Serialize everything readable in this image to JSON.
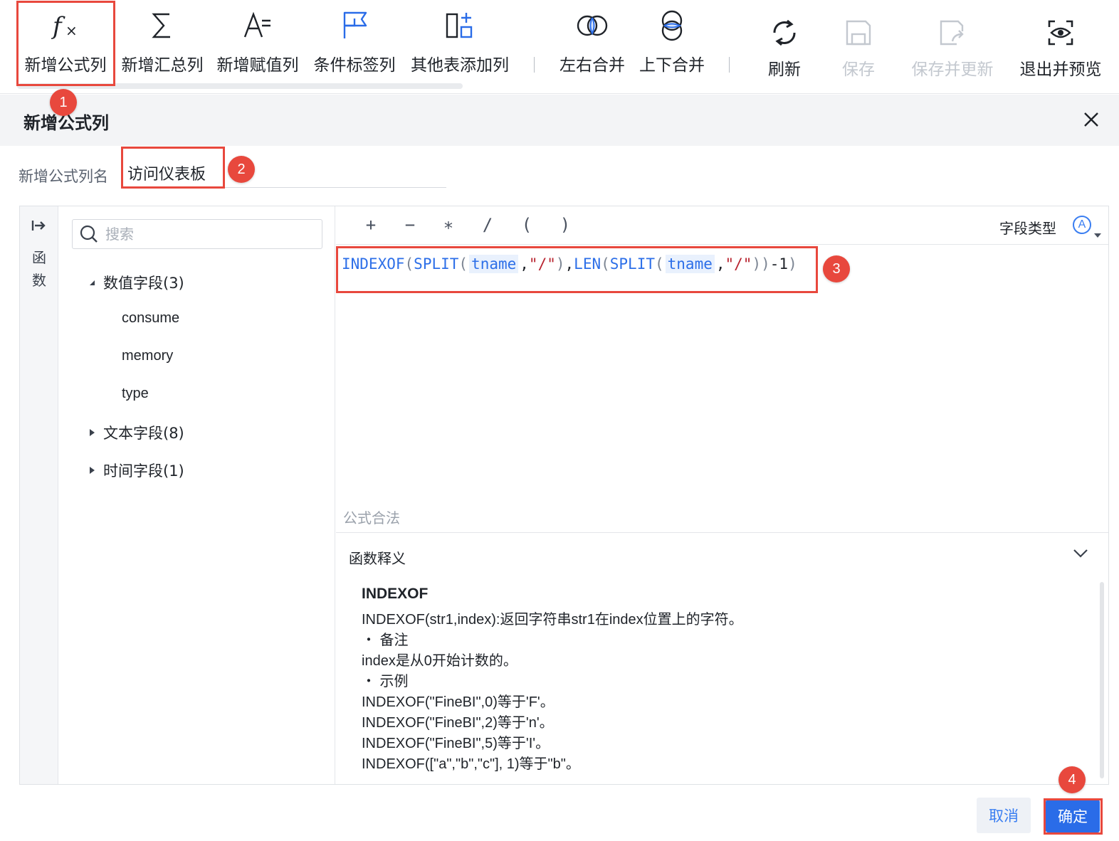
{
  "toolbar": {
    "left_items": [
      {
        "label": "新增公式列",
        "icon": "fx-icon"
      },
      {
        "label": "新增汇总列",
        "icon": "sigma-icon"
      },
      {
        "label": "新增赋值列",
        "icon": "assign-icon"
      },
      {
        "label": "条件标签列",
        "icon": "flag-icon"
      },
      {
        "label": "其他表添加列",
        "icon": "add-column-icon"
      },
      {
        "label": "左右合并",
        "icon": "merge-horizontal-icon"
      },
      {
        "label": "上下合并",
        "icon": "merge-vertical-icon"
      }
    ],
    "right_items": [
      {
        "label": "刷新",
        "icon": "refresh-icon",
        "enabled": true
      },
      {
        "label": "保存",
        "icon": "save-icon",
        "enabled": false
      },
      {
        "label": "保存并更新",
        "icon": "save-update-icon",
        "enabled": false
      },
      {
        "label": "退出并预览",
        "icon": "preview-icon",
        "enabled": true
      }
    ]
  },
  "annotations": [
    "1",
    "2",
    "3",
    "4"
  ],
  "panel": {
    "title": "新增公式列",
    "name_label": "新增公式列名",
    "name_value": "访问仪表板"
  },
  "sidebar": {
    "func_label_line1": "函",
    "func_label_line2": "数",
    "search_placeholder": "搜索",
    "groups": [
      {
        "label": "数值字段(3)",
        "expanded": true,
        "fields": [
          "consume",
          "memory",
          "type"
        ]
      },
      {
        "label": "文本字段(8)",
        "expanded": false
      },
      {
        "label": "时间字段(1)",
        "expanded": false
      }
    ]
  },
  "editor": {
    "operators": [
      "+",
      "−",
      "∗",
      "/",
      "(",
      ")"
    ],
    "field_type_label": "字段类型",
    "field_type_icon_text": "A",
    "formula_tokens": {
      "fn1": "INDEXOF",
      "p1": "(",
      "fn2": "SPLIT",
      "p2": "(",
      "field1": "tname",
      "c1": ",",
      "str1": "\"/\"",
      "p3": ")",
      "c2": ",",
      "fn3": "LEN",
      "p4": "(",
      "fn4": "SPLIT",
      "p5": "(",
      "field2": "tname",
      "c3": ",",
      "str2": "\"/\"",
      "p6": ")",
      "p7": ")",
      "tail": "-1",
      "p8": ")"
    },
    "valid_text": "公式合法",
    "explain_title": "函数释义",
    "explain": {
      "fn_name": "INDEXOF",
      "lines": [
        "INDEXOF(str1,index):返回字符串str1在index位置上的字符。",
        "・ 备注",
        "index是从0开始计数的。",
        "・ 示例",
        "INDEXOF(\"FineBI\",0)等于'F'。",
        "INDEXOF(\"FineBI\",2)等于'n'。",
        "INDEXOF(\"FineBI\",5)等于'I'。",
        "INDEXOF([\"a\",\"b\",\"c\"], 1)等于\"b\"。"
      ]
    }
  },
  "footer": {
    "cancel_label": "取消",
    "ok_label": "确定"
  },
  "colors": {
    "accent": "#2a6ce8",
    "highlight": "#e8483d",
    "disabled": "#c3c8cf"
  }
}
